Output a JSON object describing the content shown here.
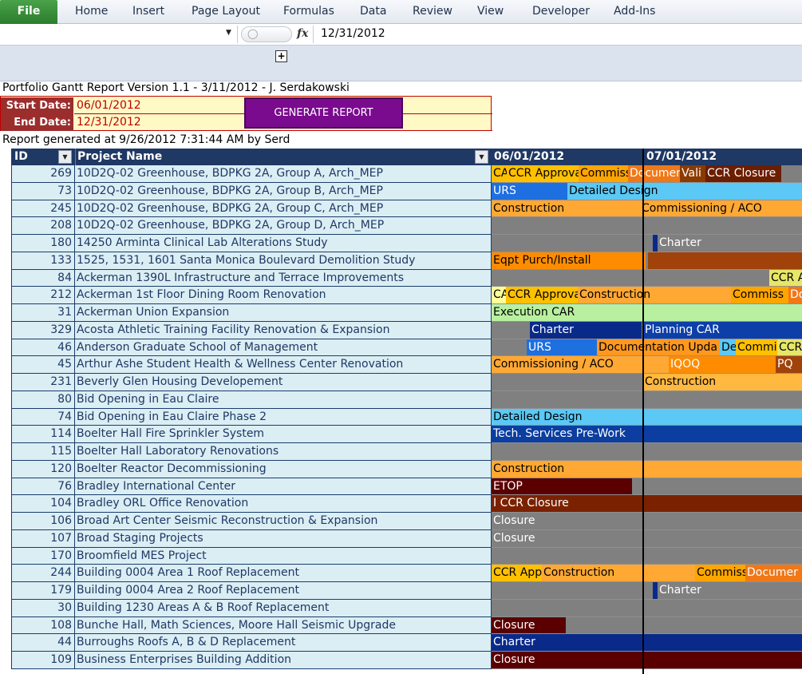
{
  "ribbon": {
    "tabs": [
      "File",
      "Home",
      "Insert",
      "Page Layout",
      "Formulas",
      "Data",
      "Review",
      "View",
      "Developer",
      "Add-Ins"
    ]
  },
  "formula_bar": {
    "fx_label": "fx",
    "value": "12/31/2012"
  },
  "outline": {
    "expand_label": "+"
  },
  "report": {
    "title": "Portfolio Gantt Report Version 1.1 - 3/11/2012 - J. Serdakowski",
    "start_label": "Start Date:",
    "start_value": "06/01/2012",
    "end_label": "End Date:",
    "end_value": "12/31/2012",
    "generate_button": "GENERATE REPORT",
    "generated_text": "Report generated at 9/26/2012 7:31:44 AM by Serd"
  },
  "grid": {
    "headers": {
      "id": "ID",
      "name": "Project Name",
      "month1": "06/01/2012",
      "month2": "07/01/2012"
    }
  },
  "colors": {
    "header_bg": "#1f3864",
    "row_bg": "#dbeef4",
    "gantt_bg": "#808080",
    "generate_button": "#7a0a8e",
    "param_label_bg": "#9b2d2d",
    "param_value_bg": "#fff9c6"
  },
  "rows": [
    {
      "id": "269",
      "name": "10D2Q-02 Greenhouse, BDPKG 2A, Group A, Arch_MEP",
      "bars": [
        {
          "label": "CA",
          "color": "#ffc000",
          "text": "#000"
        },
        {
          "label": "CCR Approva",
          "color": "#ffc000",
          "text": "#000"
        },
        {
          "label": "Commiss",
          "color": "#ffa500",
          "text": "#000"
        },
        {
          "label": "Documer",
          "color": "#f07818",
          "text": "#fff"
        },
        {
          "label": "Vali",
          "color": "#8b3a00",
          "text": "#fff"
        },
        {
          "label": "CCR Closure",
          "color": "#6b1e00",
          "text": "#fff"
        }
      ]
    },
    {
      "id": "73",
      "name": "10D2Q-02 Greenhouse, BDPKG 2A, Group B, Arch_MEP",
      "bars": [
        {
          "label": "URS",
          "color": "#1e6fe0",
          "text": "#fff"
        },
        {
          "label": "Detailed Design",
          "color": "#5bc8f5",
          "text": "#000"
        }
      ]
    },
    {
      "id": "245",
      "name": "10D2Q-02 Greenhouse, BDPKG 2A, Group C, Arch_MEP",
      "bars": [
        {
          "label": "Construction",
          "color": "#ffa833",
          "text": "#000"
        },
        {
          "label": "Commissioning / ACO",
          "color": "#ffa833",
          "text": "#000"
        }
      ]
    },
    {
      "id": "208",
      "name": "10D2Q-02 Greenhouse, BDPKG 2A, Group D, Arch_MEP",
      "bars": []
    },
    {
      "id": "180",
      "name": "14250 Arminta Clinical Lab Alterations Study",
      "bars": [
        {
          "label": "",
          "color": "#0a2a8a",
          "text": "#fff"
        },
        {
          "label": "Charter",
          "color": "#808080",
          "text": "#fff"
        }
      ]
    },
    {
      "id": "133",
      "name": "1525, 1531, 1601 Santa Monica Boulevard Demolition Study",
      "bars": [
        {
          "label": "Eqpt Purch/Install",
          "color": "#ff8c00",
          "text": "#000"
        },
        {
          "label": "",
          "color": "#a0420a",
          "text": "#fff"
        }
      ]
    },
    {
      "id": "84",
      "name": "Ackerman 1390L Infrastructure and Terrace Improvements",
      "bars": [
        {
          "label": "CCR A",
          "color": "#e6e66a",
          "text": "#000"
        }
      ]
    },
    {
      "id": "212",
      "name": "Ackerman 1st Floor Dining Room Renovation",
      "bars": [
        {
          "label": "CA",
          "color": "#ffff99",
          "text": "#000"
        },
        {
          "label": "CCR Approva",
          "color": "#ffc000",
          "text": "#000"
        },
        {
          "label": "Construction",
          "color": "#ffa833",
          "text": "#000"
        },
        {
          "label": "Commiss",
          "color": "#ffa500",
          "text": "#000"
        },
        {
          "label": "Doc",
          "color": "#f07818",
          "text": "#fff"
        }
      ]
    },
    {
      "id": "31",
      "name": "Ackerman Union Expansion",
      "bars": [
        {
          "label": "Execution CAR",
          "color": "#b8f0a0",
          "text": "#000"
        }
      ]
    },
    {
      "id": "329",
      "name": "Acosta Athletic Training Facility Renovation & Expansion",
      "bars": [
        {
          "label": "Charter",
          "color": "#0a2a8a",
          "text": "#fff"
        },
        {
          "label": "Planning CAR",
          "color": "#0d3fa8",
          "text": "#fff"
        }
      ]
    },
    {
      "id": "46",
      "name": "Anderson Graduate School of Management",
      "bars": [
        {
          "label": "URS",
          "color": "#1e6fe0",
          "text": "#fff"
        },
        {
          "label": "Documentation Upda",
          "color": "#ff9820",
          "text": "#000"
        },
        {
          "label": "De",
          "color": "#5bc8f5",
          "text": "#000"
        },
        {
          "label": "Commi",
          "color": "#ffc000",
          "text": "#000"
        },
        {
          "label": "CCR",
          "color": "#e6e66a",
          "text": "#000"
        }
      ]
    },
    {
      "id": "45",
      "name": "Arthur Ashe Student Health & Wellness Center Renovation",
      "bars": [
        {
          "label": "Commissioning / ACO",
          "color": "#ffa833",
          "text": "#000"
        },
        {
          "label": "IQOQ",
          "color": "#ff8c00",
          "text": "#fff"
        },
        {
          "label": "PQ",
          "color": "#a0420a",
          "text": "#fff"
        }
      ]
    },
    {
      "id": "231",
      "name": "Beverly Glen Housing Developement",
      "bars": [
        {
          "label": "Construction",
          "color": "#ffb840",
          "text": "#000"
        }
      ]
    },
    {
      "id": "80",
      "name": "Bid Opening in Eau Claire",
      "bars": []
    },
    {
      "id": "74",
      "name": "Bid Opening in Eau Claire Phase 2",
      "bars": [
        {
          "label": "Detailed Design",
          "color": "#5bc8f5",
          "text": "#000"
        }
      ]
    },
    {
      "id": "114",
      "name": "Boelter Hall Fire Sprinkler System",
      "bars": [
        {
          "label": "Tech. Services Pre-Work",
          "color": "#0b3ea0",
          "text": "#fff"
        }
      ]
    },
    {
      "id": "115",
      "name": "Boelter Hall Laboratory Renovations",
      "bars": []
    },
    {
      "id": "120",
      "name": "Boelter Reactor Decommissioning",
      "bars": [
        {
          "label": "Construction",
          "color": "#ffa833",
          "text": "#000"
        }
      ]
    },
    {
      "id": "76",
      "name": "Bradley International Center",
      "bars": [
        {
          "label": "ETOP",
          "color": "#5a0000",
          "text": "#fff"
        }
      ]
    },
    {
      "id": "104",
      "name": "Bradley ORL Office Renovation",
      "bars": [
        {
          "label": "I CCR Closure",
          "color": "#7a2200",
          "text": "#fff"
        }
      ]
    },
    {
      "id": "106",
      "name": "Broad Art Center Seismic Reconstruction & Expansion",
      "bars": [
        {
          "label": "Closure",
          "color": "#808080",
          "text": "#fff"
        }
      ]
    },
    {
      "id": "107",
      "name": "Broad Staging Projects",
      "bars": [
        {
          "label": "Closure",
          "color": "#808080",
          "text": "#fff"
        }
      ]
    },
    {
      "id": "170",
      "name": "Broomfield MES Project",
      "bars": []
    },
    {
      "id": "244",
      "name": "Building 0004 Area 1 Roof Replacement",
      "bars": [
        {
          "label": "CCR Appr",
          "color": "#ffc000",
          "text": "#000"
        },
        {
          "label": "Construction",
          "color": "#ffa833",
          "text": "#000"
        },
        {
          "label": "Commiss",
          "color": "#ffa500",
          "text": "#000"
        },
        {
          "label": "Documer",
          "color": "#f07818",
          "text": "#fff"
        }
      ]
    },
    {
      "id": "179",
      "name": "Building 0004 Area 2 Roof Replacement",
      "bars": [
        {
          "label": "",
          "color": "#0a2a8a",
          "text": "#fff"
        },
        {
          "label": "Charter",
          "color": "#808080",
          "text": "#fff"
        }
      ]
    },
    {
      "id": "30",
      "name": "Building 1230 Areas A & B Roof Replacement",
      "bars": []
    },
    {
      "id": "108",
      "name": "Bunche Hall, Math Sciences, Moore Hall Seismic Upgrade",
      "bars": [
        {
          "label": "Closure",
          "color": "#5a0000",
          "text": "#fff"
        }
      ]
    },
    {
      "id": "44",
      "name": "Burroughs Roofs A, B & D Replacement",
      "bars": [
        {
          "label": "Charter",
          "color": "#0a2a8a",
          "text": "#fff"
        }
      ]
    },
    {
      "id": "109",
      "name": "Business Enterprises Building Addition",
      "bars": [
        {
          "label": "Closure",
          "color": "#5a0000",
          "text": "#fff"
        }
      ]
    }
  ]
}
